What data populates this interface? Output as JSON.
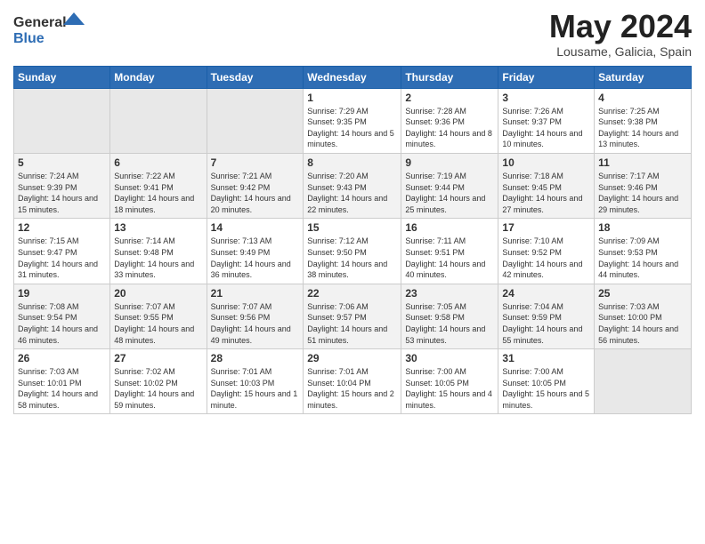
{
  "logo": {
    "general": "General",
    "blue": "Blue"
  },
  "title": {
    "month_year": "May 2024",
    "location": "Lousame, Galicia, Spain"
  },
  "weekdays": [
    "Sunday",
    "Monday",
    "Tuesday",
    "Wednesday",
    "Thursday",
    "Friday",
    "Saturday"
  ],
  "weeks": [
    [
      {
        "day": "",
        "sunrise": "",
        "sunset": "",
        "daylight": ""
      },
      {
        "day": "",
        "sunrise": "",
        "sunset": "",
        "daylight": ""
      },
      {
        "day": "",
        "sunrise": "",
        "sunset": "",
        "daylight": ""
      },
      {
        "day": "1",
        "sunrise": "Sunrise: 7:29 AM",
        "sunset": "Sunset: 9:35 PM",
        "daylight": "Daylight: 14 hours and 5 minutes."
      },
      {
        "day": "2",
        "sunrise": "Sunrise: 7:28 AM",
        "sunset": "Sunset: 9:36 PM",
        "daylight": "Daylight: 14 hours and 8 minutes."
      },
      {
        "day": "3",
        "sunrise": "Sunrise: 7:26 AM",
        "sunset": "Sunset: 9:37 PM",
        "daylight": "Daylight: 14 hours and 10 minutes."
      },
      {
        "day": "4",
        "sunrise": "Sunrise: 7:25 AM",
        "sunset": "Sunset: 9:38 PM",
        "daylight": "Daylight: 14 hours and 13 minutes."
      }
    ],
    [
      {
        "day": "5",
        "sunrise": "Sunrise: 7:24 AM",
        "sunset": "Sunset: 9:39 PM",
        "daylight": "Daylight: 14 hours and 15 minutes."
      },
      {
        "day": "6",
        "sunrise": "Sunrise: 7:22 AM",
        "sunset": "Sunset: 9:41 PM",
        "daylight": "Daylight: 14 hours and 18 minutes."
      },
      {
        "day": "7",
        "sunrise": "Sunrise: 7:21 AM",
        "sunset": "Sunset: 9:42 PM",
        "daylight": "Daylight: 14 hours and 20 minutes."
      },
      {
        "day": "8",
        "sunrise": "Sunrise: 7:20 AM",
        "sunset": "Sunset: 9:43 PM",
        "daylight": "Daylight: 14 hours and 22 minutes."
      },
      {
        "day": "9",
        "sunrise": "Sunrise: 7:19 AM",
        "sunset": "Sunset: 9:44 PM",
        "daylight": "Daylight: 14 hours and 25 minutes."
      },
      {
        "day": "10",
        "sunrise": "Sunrise: 7:18 AM",
        "sunset": "Sunset: 9:45 PM",
        "daylight": "Daylight: 14 hours and 27 minutes."
      },
      {
        "day": "11",
        "sunrise": "Sunrise: 7:17 AM",
        "sunset": "Sunset: 9:46 PM",
        "daylight": "Daylight: 14 hours and 29 minutes."
      }
    ],
    [
      {
        "day": "12",
        "sunrise": "Sunrise: 7:15 AM",
        "sunset": "Sunset: 9:47 PM",
        "daylight": "Daylight: 14 hours and 31 minutes."
      },
      {
        "day": "13",
        "sunrise": "Sunrise: 7:14 AM",
        "sunset": "Sunset: 9:48 PM",
        "daylight": "Daylight: 14 hours and 33 minutes."
      },
      {
        "day": "14",
        "sunrise": "Sunrise: 7:13 AM",
        "sunset": "Sunset: 9:49 PM",
        "daylight": "Daylight: 14 hours and 36 minutes."
      },
      {
        "day": "15",
        "sunrise": "Sunrise: 7:12 AM",
        "sunset": "Sunset: 9:50 PM",
        "daylight": "Daylight: 14 hours and 38 minutes."
      },
      {
        "day": "16",
        "sunrise": "Sunrise: 7:11 AM",
        "sunset": "Sunset: 9:51 PM",
        "daylight": "Daylight: 14 hours and 40 minutes."
      },
      {
        "day": "17",
        "sunrise": "Sunrise: 7:10 AM",
        "sunset": "Sunset: 9:52 PM",
        "daylight": "Daylight: 14 hours and 42 minutes."
      },
      {
        "day": "18",
        "sunrise": "Sunrise: 7:09 AM",
        "sunset": "Sunset: 9:53 PM",
        "daylight": "Daylight: 14 hours and 44 minutes."
      }
    ],
    [
      {
        "day": "19",
        "sunrise": "Sunrise: 7:08 AM",
        "sunset": "Sunset: 9:54 PM",
        "daylight": "Daylight: 14 hours and 46 minutes."
      },
      {
        "day": "20",
        "sunrise": "Sunrise: 7:07 AM",
        "sunset": "Sunset: 9:55 PM",
        "daylight": "Daylight: 14 hours and 48 minutes."
      },
      {
        "day": "21",
        "sunrise": "Sunrise: 7:07 AM",
        "sunset": "Sunset: 9:56 PM",
        "daylight": "Daylight: 14 hours and 49 minutes."
      },
      {
        "day": "22",
        "sunrise": "Sunrise: 7:06 AM",
        "sunset": "Sunset: 9:57 PM",
        "daylight": "Daylight: 14 hours and 51 minutes."
      },
      {
        "day": "23",
        "sunrise": "Sunrise: 7:05 AM",
        "sunset": "Sunset: 9:58 PM",
        "daylight": "Daylight: 14 hours and 53 minutes."
      },
      {
        "day": "24",
        "sunrise": "Sunrise: 7:04 AM",
        "sunset": "Sunset: 9:59 PM",
        "daylight": "Daylight: 14 hours and 55 minutes."
      },
      {
        "day": "25",
        "sunrise": "Sunrise: 7:03 AM",
        "sunset": "Sunset: 10:00 PM",
        "daylight": "Daylight: 14 hours and 56 minutes."
      }
    ],
    [
      {
        "day": "26",
        "sunrise": "Sunrise: 7:03 AM",
        "sunset": "Sunset: 10:01 PM",
        "daylight": "Daylight: 14 hours and 58 minutes."
      },
      {
        "day": "27",
        "sunrise": "Sunrise: 7:02 AM",
        "sunset": "Sunset: 10:02 PM",
        "daylight": "Daylight: 14 hours and 59 minutes."
      },
      {
        "day": "28",
        "sunrise": "Sunrise: 7:01 AM",
        "sunset": "Sunset: 10:03 PM",
        "daylight": "Daylight: 15 hours and 1 minute."
      },
      {
        "day": "29",
        "sunrise": "Sunrise: 7:01 AM",
        "sunset": "Sunset: 10:04 PM",
        "daylight": "Daylight: 15 hours and 2 minutes."
      },
      {
        "day": "30",
        "sunrise": "Sunrise: 7:00 AM",
        "sunset": "Sunset: 10:05 PM",
        "daylight": "Daylight: 15 hours and 4 minutes."
      },
      {
        "day": "31",
        "sunrise": "Sunrise: 7:00 AM",
        "sunset": "Sunset: 10:05 PM",
        "daylight": "Daylight: 15 hours and 5 minutes."
      },
      {
        "day": "",
        "sunrise": "",
        "sunset": "",
        "daylight": ""
      }
    ]
  ]
}
